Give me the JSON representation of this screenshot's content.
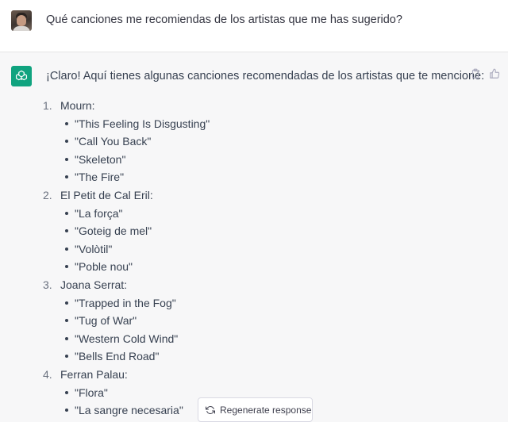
{
  "user": {
    "question": "Qué canciones me recomiendas de los artistas que me has sugerido?"
  },
  "assistant": {
    "intro": "¡Claro! Aquí tienes algunas canciones recomendadas de los artistas que te mencioné:",
    "artists": [
      {
        "num": "1.",
        "name": "Mourn:",
        "songs": [
          "\"This Feeling Is Disgusting\"",
          "\"Call You Back\"",
          "\"Skeleton\"",
          "\"The Fire\""
        ]
      },
      {
        "num": "2.",
        "name": "El Petit de Cal Eril:",
        "songs": [
          "\"La força\"",
          "\"Goteig de mel\"",
          "\"Volòtil\"",
          "\"Poble nou\""
        ]
      },
      {
        "num": "3.",
        "name": "Joana Serrat:",
        "songs": [
          "\"Trapped in the Fog\"",
          "\"Tug of War\"",
          "\"Western Cold Wind\"",
          "\"Bells End Road\""
        ]
      },
      {
        "num": "4.",
        "name": "Ferran Palau:",
        "songs": [
          "\"Flora\"",
          "\"La sangre necesaria\""
        ]
      }
    ],
    "icons": {
      "avatar": "openai-logo-icon",
      "copy": "clipboard-icon",
      "like": "thumbs-up-icon"
    }
  },
  "regenerate": {
    "label": "Regenerate response",
    "icon": "refresh-icon"
  },
  "colors": {
    "accent": "#10a37f",
    "bot_bg": "#f7f7f8"
  }
}
